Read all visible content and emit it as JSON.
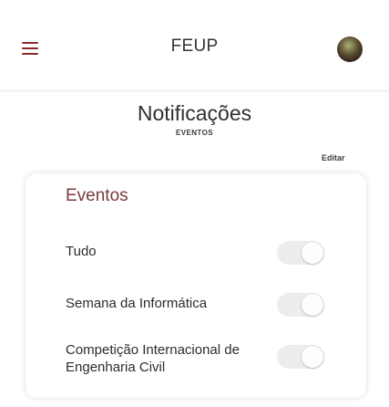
{
  "header": {
    "title": "FEUP",
    "menu_icon": "hamburger-menu-icon",
    "avatar_icon": "user-avatar"
  },
  "page": {
    "title": "Notificações",
    "subtitle": "EVENTOS",
    "edit_label": "Editar"
  },
  "card": {
    "section_title": "Eventos",
    "rows": [
      {
        "label": "Tudo",
        "enabled": false
      },
      {
        "label": "Semana da Informática",
        "enabled": false
      },
      {
        "label": "Competição Internacional de Engenharia Civil",
        "enabled": false
      }
    ]
  },
  "colors": {
    "accent": "#8a2b2b",
    "section_title": "#7a3b3b",
    "toggle_off": "#ededed"
  }
}
